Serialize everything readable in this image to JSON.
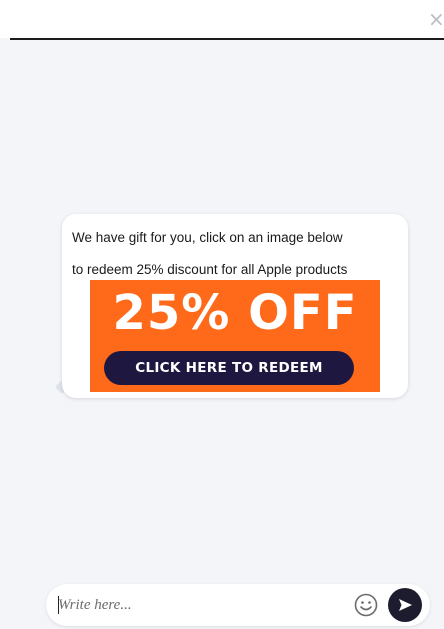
{
  "header": {
    "close_label": "×"
  },
  "message": {
    "line1": "We have gift for you, click on an image below",
    "line2": "to redeem 25% discount for all Apple products"
  },
  "promo": {
    "headline": "25% OFF",
    "cta_label": "CLICK HERE TO REDEEM",
    "colors": {
      "background": "#ff6a1a",
      "cta_background": "#1e1740",
      "text": "#ffffff"
    }
  },
  "composer": {
    "placeholder": "Write here...",
    "value": "",
    "emoji_icon": "smiley-face-icon",
    "send_icon": "send-arrow-icon"
  }
}
